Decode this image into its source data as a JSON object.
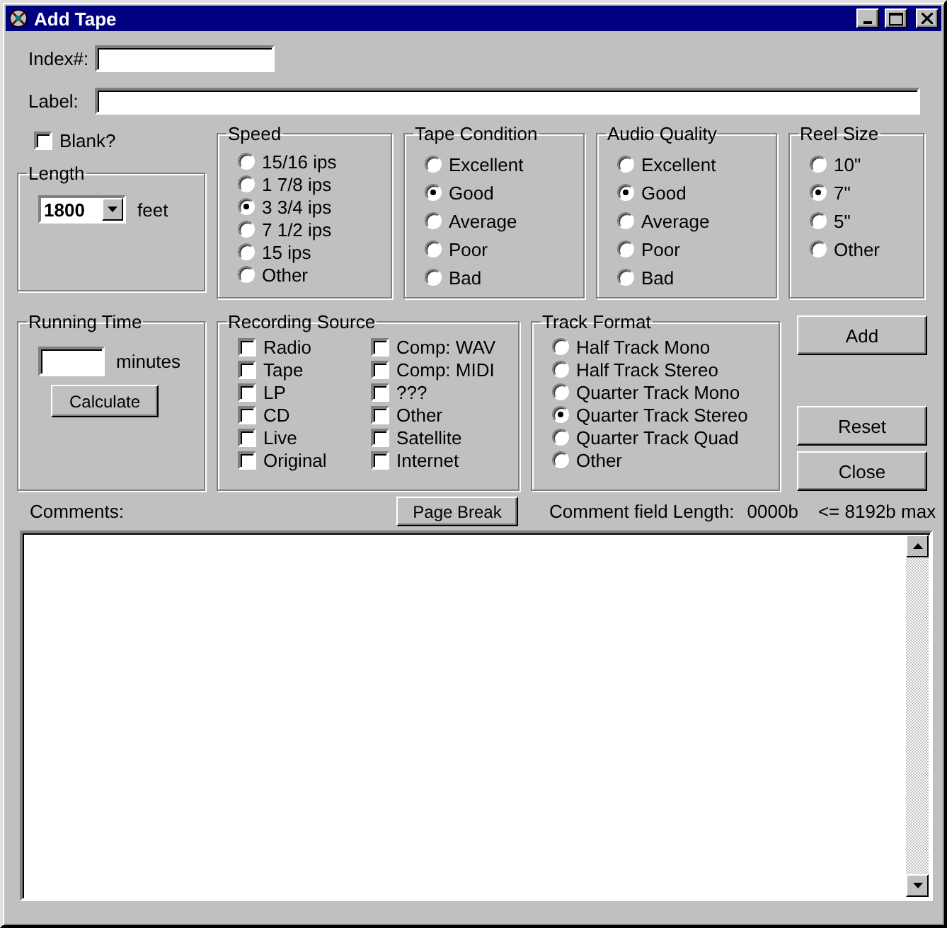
{
  "window": {
    "title": "Add Tape"
  },
  "index_field": {
    "label": "Index#:"
  },
  "label_field": {
    "label": "Label:"
  },
  "blank": {
    "label": "Blank?",
    "checked": false
  },
  "length": {
    "title": "Length",
    "value": "1800",
    "unit": "feet"
  },
  "radio_groups": [
    {
      "title": "Speed",
      "options": [
        {
          "label": "15/16 ips",
          "selected": false
        },
        {
          "label": "1 7/8 ips",
          "selected": false
        },
        {
          "label": "3 3/4 ips",
          "selected": true
        },
        {
          "label": "7 1/2 ips",
          "selected": false
        },
        {
          "label": "15 ips",
          "selected": false
        },
        {
          "label": "Other",
          "selected": false
        }
      ]
    },
    {
      "title": "Tape Condition",
      "options": [
        {
          "label": "Excellent",
          "selected": false
        },
        {
          "label": "Good",
          "selected": true
        },
        {
          "label": "Average",
          "selected": false
        },
        {
          "label": "Poor",
          "selected": false
        },
        {
          "label": "Bad",
          "selected": false
        }
      ]
    },
    {
      "title": "Audio Quality",
      "options": [
        {
          "label": "Excellent",
          "selected": false
        },
        {
          "label": "Good",
          "selected": true
        },
        {
          "label": "Average",
          "selected": false
        },
        {
          "label": "Poor",
          "selected": false
        },
        {
          "label": "Bad",
          "selected": false
        }
      ]
    },
    {
      "title": "Reel Size",
      "options": [
        {
          "label": "10\"",
          "selected": false
        },
        {
          "label": "7\"",
          "selected": true
        },
        {
          "label": "5\"",
          "selected": false
        },
        {
          "label": "Other",
          "selected": false
        }
      ]
    }
  ],
  "running_time": {
    "title": "Running Time",
    "unit": "minutes",
    "button": "Calculate"
  },
  "recording_source": {
    "title": "Recording Source",
    "options": [
      {
        "label": "Radio",
        "checked": false
      },
      {
        "label": "Tape",
        "checked": false
      },
      {
        "label": "LP",
        "checked": false
      },
      {
        "label": "CD",
        "checked": false
      },
      {
        "label": "Live",
        "checked": false
      },
      {
        "label": "Original",
        "checked": false
      },
      {
        "label": "Comp: WAV",
        "checked": false
      },
      {
        "label": "Comp: MIDI",
        "checked": false
      },
      {
        "label": "???",
        "checked": false
      },
      {
        "label": "Other",
        "checked": false
      },
      {
        "label": "Satellite",
        "checked": false
      },
      {
        "label": "Internet",
        "checked": false
      }
    ]
  },
  "track_format": {
    "title": "Track Format",
    "options": [
      {
        "label": "Half Track Mono",
        "selected": false
      },
      {
        "label": "Half Track Stereo",
        "selected": false
      },
      {
        "label": "Quarter Track Mono",
        "selected": false
      },
      {
        "label": "Quarter Track Stereo",
        "selected": true
      },
      {
        "label": "Quarter Track Quad",
        "selected": false
      },
      {
        "label": "Other",
        "selected": false
      }
    ]
  },
  "buttons": [
    "Add",
    "Reset",
    "Close"
  ],
  "comments": {
    "label": "Comments:",
    "page_break": "Page Break",
    "length_label": "Comment field Length:",
    "length_value": "0000b",
    "max": "<= 8192b max"
  }
}
